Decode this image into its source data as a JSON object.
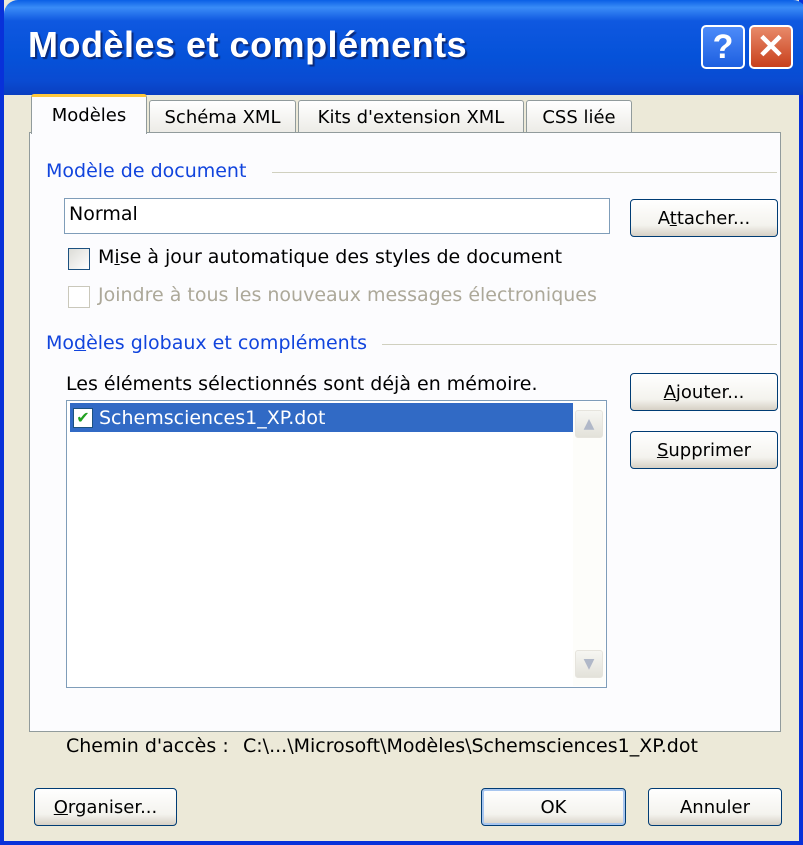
{
  "window": {
    "title": "Modèles et compléments",
    "help_glyph": "?",
    "close_glyph": "✕"
  },
  "tabs": [
    {
      "label": "Modèles",
      "active": true
    },
    {
      "label": "Schéma XML",
      "active": false
    },
    {
      "label": "Kits d'extension XML",
      "active": false
    },
    {
      "label": "CSS liée",
      "active": false
    }
  ],
  "document_template": {
    "group_label": "Modèle de document",
    "value": "Normal",
    "attach_button": {
      "pre": "A",
      "u": "t",
      "post": "tacher..."
    },
    "auto_update": {
      "checked": false,
      "pre": "M",
      "u": "i",
      "post": "se à jour automatique des styles de document"
    },
    "attach_email": {
      "checked": false,
      "disabled": true,
      "label": "Joindre à tous les nouveaux messages électroniques"
    }
  },
  "global_templates": {
    "group_label_pre": "Mo",
    "group_label_u": "d",
    "group_label_post": "èles globaux et compléments",
    "note": "Les éléments sélectionnés sont déjà en mémoire.",
    "items": [
      {
        "label": "Schemsciences1_XP.dot",
        "checked": true,
        "selected": true
      }
    ],
    "add_button": {
      "u": "A",
      "post": "jouter..."
    },
    "remove_button": {
      "u": "S",
      "post": "upprimer"
    },
    "path_label": "Chemin d'accès :",
    "path_value": "C:\\...\\Microsoft\\Modèles\\Schemsciences1_XP.dot"
  },
  "footer": {
    "organize_button": {
      "u": "O",
      "post": "rganiser..."
    },
    "ok_button": "OK",
    "cancel_button": "Annuler"
  },
  "colors": {
    "title_bar": "#0552d9",
    "group_label": "#1144dd",
    "selection": "#316ac5",
    "dialog_bg": "#ece9d8"
  },
  "icons": {
    "help": "help-icon",
    "close": "close-icon",
    "checkmark": "checkmark-icon",
    "scroll_up": "chevron-up-icon",
    "scroll_down": "chevron-down-icon"
  }
}
